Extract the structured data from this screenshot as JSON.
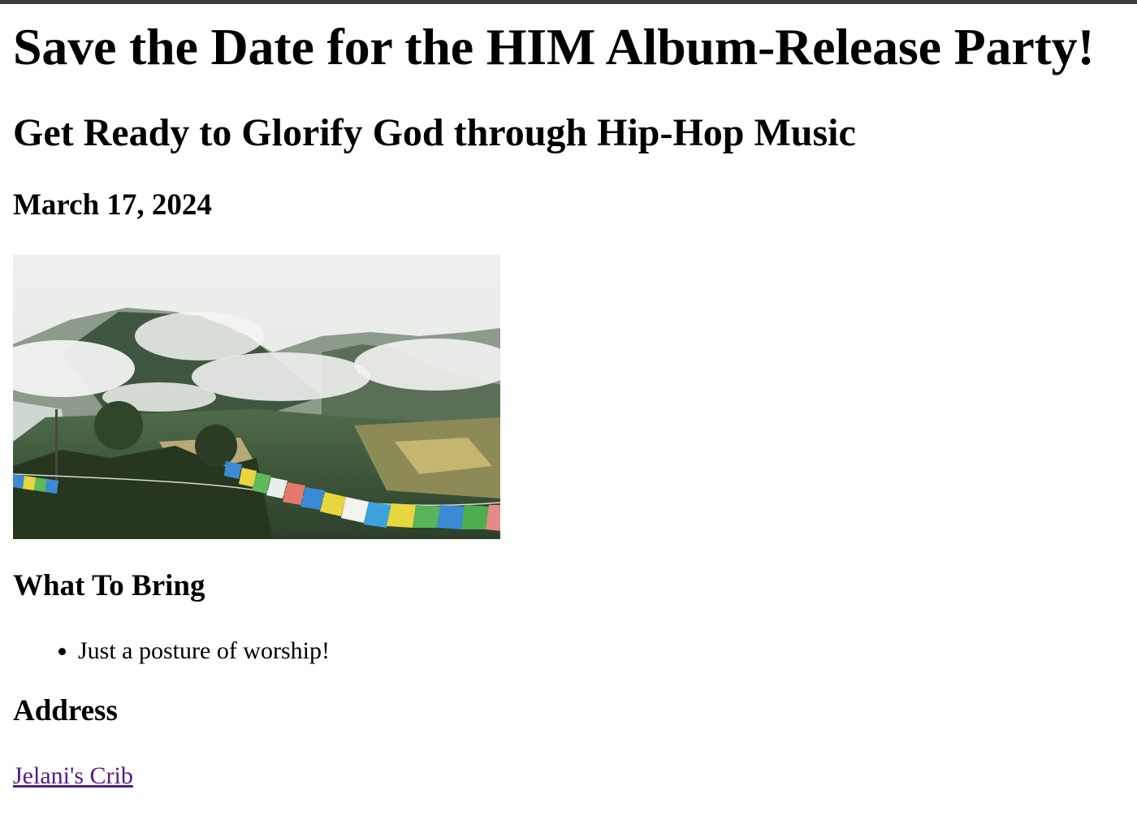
{
  "page": {
    "title": "Save the Date for the HIM Album-Release Party!",
    "subtitle": "Get Ready to Glorify God through Hip-Hop Music",
    "date": "March 17, 2024"
  },
  "image": {
    "icon": "landscape-photo-mountains-prayer-flags"
  },
  "bring": {
    "heading": "What To Bring",
    "items": [
      "Just a posture of worship!"
    ]
  },
  "address": {
    "heading": "Address",
    "link_text": "Jelani's Crib"
  },
  "colors": {
    "visited_link": "#551a8b",
    "text": "#000000",
    "background": "#ffffff"
  }
}
